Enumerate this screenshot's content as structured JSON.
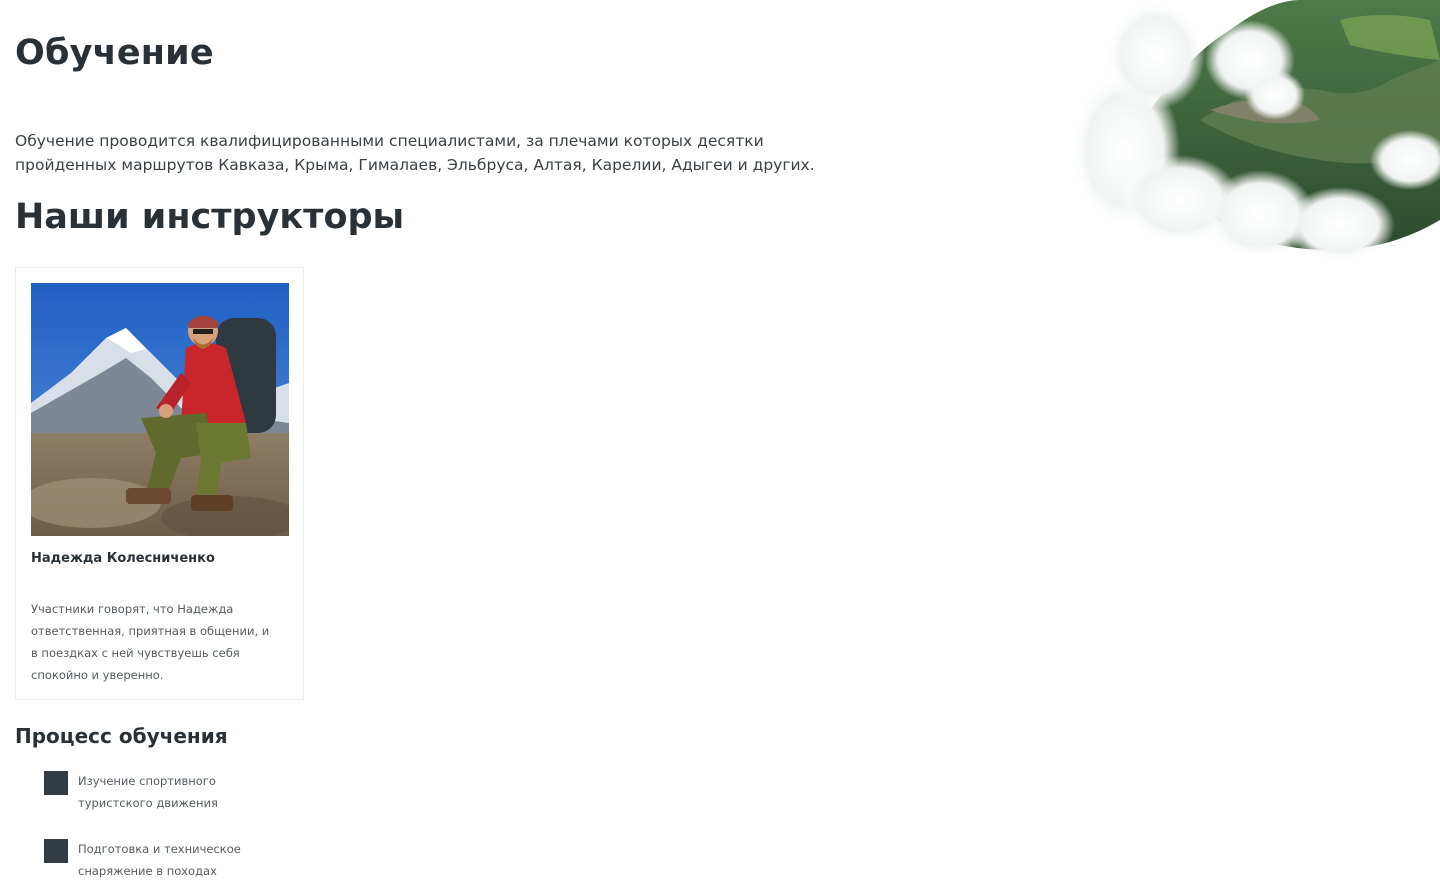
{
  "page": {
    "title": "Обучение",
    "intro": "Обучение проводится квалифицированными специалистами, за плечами которых десятки пройденных маршрутов Кавказа, Крыма, Гималаев, Эльбруса, Алтая, Карелии, Адыгеи и других."
  },
  "instructors": {
    "title": "Наши инструкторы",
    "cards": [
      {
        "name": "Надежда Колесниченко",
        "description": "Участники говорят, что Надежда ответственная, приятная в общении, и в поездках с ней чувствуешь себя спокойно и уверенно.",
        "photo_icon": "hiker-photo"
      }
    ]
  },
  "process": {
    "title": "Процесс обучения",
    "steps": [
      {
        "text": "Изучение спортивного туристского движения"
      },
      {
        "text": "Подготовка и техническое снаряжение в походах"
      }
    ]
  },
  "colors": {
    "heading": "#2a3136",
    "bullet": "#323c42",
    "body_text": "#555b60"
  },
  "decor": {
    "hero_icon": "mountain-clouds-image"
  }
}
